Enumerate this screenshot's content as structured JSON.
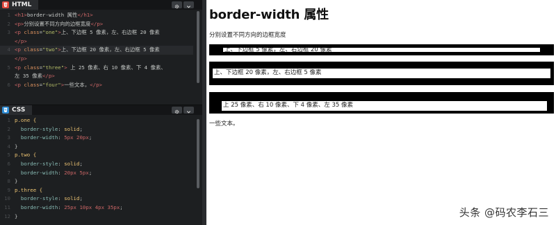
{
  "html_panel": {
    "tab_label": "HTML",
    "lines": [
      {
        "n": "1",
        "parts": [
          [
            "t-tag",
            "<h1>"
          ],
          [
            "t-txt",
            "border-width 属性"
          ],
          [
            "t-tag",
            "</h1>"
          ]
        ]
      },
      {
        "n": "2",
        "parts": [
          [
            "t-tag",
            "<p>"
          ],
          [
            "t-txt",
            "分别设置不同方向的边框宽度"
          ],
          [
            "t-tag",
            "</p>"
          ]
        ]
      },
      {
        "n": "3",
        "parts": [
          [
            "t-tag",
            "<p "
          ],
          [
            "t-attr",
            "class"
          ],
          [
            "t-txt",
            "="
          ],
          [
            "t-str",
            "\"one\""
          ],
          [
            "t-tag",
            ">"
          ],
          [
            "t-txt",
            "上、下边框 5 像素，左、右边框 20 像素"
          ]
        ]
      },
      {
        "n": "",
        "parts": [
          [
            "t-tag",
            "</p>"
          ]
        ]
      },
      {
        "n": "4",
        "parts": [
          [
            "t-tag",
            "<p "
          ],
          [
            "t-attr",
            "class"
          ],
          [
            "t-txt",
            "="
          ],
          [
            "t-str",
            "\"two\""
          ],
          [
            "t-tag",
            ">"
          ],
          [
            "t-txt",
            "上、下边框 20 像素，左、右边框 5 像素"
          ]
        ]
      },
      {
        "n": "",
        "parts": [
          [
            "t-tag",
            "</p>"
          ]
        ]
      },
      {
        "n": "5",
        "parts": [
          [
            "t-tag",
            "<p "
          ],
          [
            "t-attr",
            "class"
          ],
          [
            "t-txt",
            "="
          ],
          [
            "t-str",
            "\"three\""
          ],
          [
            "t-tag",
            ">"
          ],
          [
            "t-txt",
            " 上 25 像素、右 10 像素、下 4 像素、"
          ]
        ]
      },
      {
        "n": "",
        "parts": [
          [
            "t-txt",
            "左 35 像素"
          ],
          [
            "t-tag",
            "</p>"
          ]
        ]
      },
      {
        "n": "6",
        "parts": [
          [
            "t-tag",
            "<p "
          ],
          [
            "t-attr",
            "class"
          ],
          [
            "t-txt",
            "="
          ],
          [
            "t-str",
            "\"four\""
          ],
          [
            "t-tag",
            ">"
          ],
          [
            "t-txt",
            "一些文本，"
          ],
          [
            "t-tag",
            "</p>"
          ]
        ]
      }
    ]
  },
  "css_panel": {
    "tab_label": "CSS",
    "lines": [
      {
        "n": "1",
        "parts": [
          [
            "t-sel",
            "p.one {"
          ]
        ]
      },
      {
        "n": "2",
        "parts": [
          [
            "t-prop",
            "  border-style"
          ],
          [
            "t-pct",
            ": "
          ],
          [
            "t-val",
            "solid"
          ],
          [
            "t-pct",
            ";"
          ]
        ]
      },
      {
        "n": "3",
        "parts": [
          [
            "t-prop",
            "  border-width"
          ],
          [
            "t-pct",
            ": "
          ],
          [
            "t-tag",
            "5px 20px"
          ],
          [
            "t-pct",
            ";"
          ]
        ]
      },
      {
        "n": "4",
        "parts": [
          [
            "t-pct",
            "}"
          ]
        ]
      },
      {
        "n": "5",
        "parts": [
          [
            "t-sel",
            "p.two {"
          ]
        ]
      },
      {
        "n": "6",
        "parts": [
          [
            "t-prop",
            "  border-style"
          ],
          [
            "t-pct",
            ": "
          ],
          [
            "t-val",
            "solid"
          ],
          [
            "t-pct",
            ";"
          ]
        ]
      },
      {
        "n": "7",
        "parts": [
          [
            "t-prop",
            "  border-width"
          ],
          [
            "t-pct",
            ": "
          ],
          [
            "t-tag",
            "20px 5px"
          ],
          [
            "t-pct",
            ";"
          ]
        ]
      },
      {
        "n": "8",
        "parts": [
          [
            "t-pct",
            "}"
          ]
        ]
      },
      {
        "n": "9",
        "parts": [
          [
            "t-sel",
            "p.three {"
          ]
        ]
      },
      {
        "n": "10",
        "parts": [
          [
            "t-prop",
            "  border-style"
          ],
          [
            "t-pct",
            ": "
          ],
          [
            "t-val",
            "solid"
          ],
          [
            "t-pct",
            ";"
          ]
        ]
      },
      {
        "n": "11",
        "parts": [
          [
            "t-prop",
            "  border-width"
          ],
          [
            "t-pct",
            ": "
          ],
          [
            "t-tag",
            "25px 10px 4px 35px"
          ],
          [
            "t-pct",
            ";"
          ]
        ]
      },
      {
        "n": "12",
        "parts": [
          [
            "t-pct",
            "}"
          ]
        ]
      }
    ]
  },
  "preview": {
    "heading": "border-width 属性",
    "intro": "分别设置不同方向的边框宽度",
    "box_one": "上、下边框 5 像素，左、右边框 20 像素",
    "box_two": "上、下边框 20 像素，左、右边框 5 像素",
    "box_three": "上 25 像素、右 10 像素、下 4 像素、左 35 像素",
    "four": "一些文本。"
  },
  "watermark": "头条 @码农李石三",
  "colors": {
    "editor_bg": "#1d1f21",
    "html_tab_icon": "#e2483d",
    "css_tab_icon": "#2d8cd6",
    "border": "#000000"
  },
  "icons": [
    "html5-icon",
    "css3-icon",
    "gear-icon",
    "chevron-down-icon"
  ]
}
